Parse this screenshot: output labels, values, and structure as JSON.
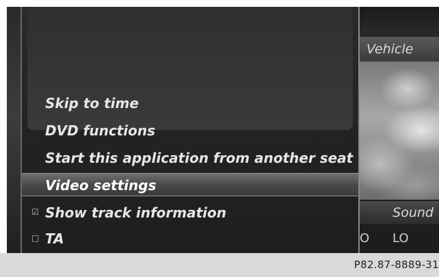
{
  "menu": {
    "items": [
      {
        "label": "Skip to time"
      },
      {
        "label": "DVD functions"
      },
      {
        "label": "Start this application from another seat"
      },
      {
        "label": "Video settings",
        "selected": true
      }
    ],
    "options": [
      {
        "label": "Show track information",
        "checked": true,
        "box_glyph": "☑"
      },
      {
        "label": "TA",
        "checked": false,
        "box_glyph": "□"
      }
    ]
  },
  "right_panel": {
    "vehicle_label": "Vehicle",
    "sound_label": "Sound",
    "eq_left": "O",
    "eq_right": "LO"
  },
  "caption": {
    "text": "P82.87-8889-31"
  },
  "colors": {
    "text": "#e6e6e6",
    "selected_bar": "#5a5a5a",
    "caption_bg": "#d9d9d9"
  }
}
